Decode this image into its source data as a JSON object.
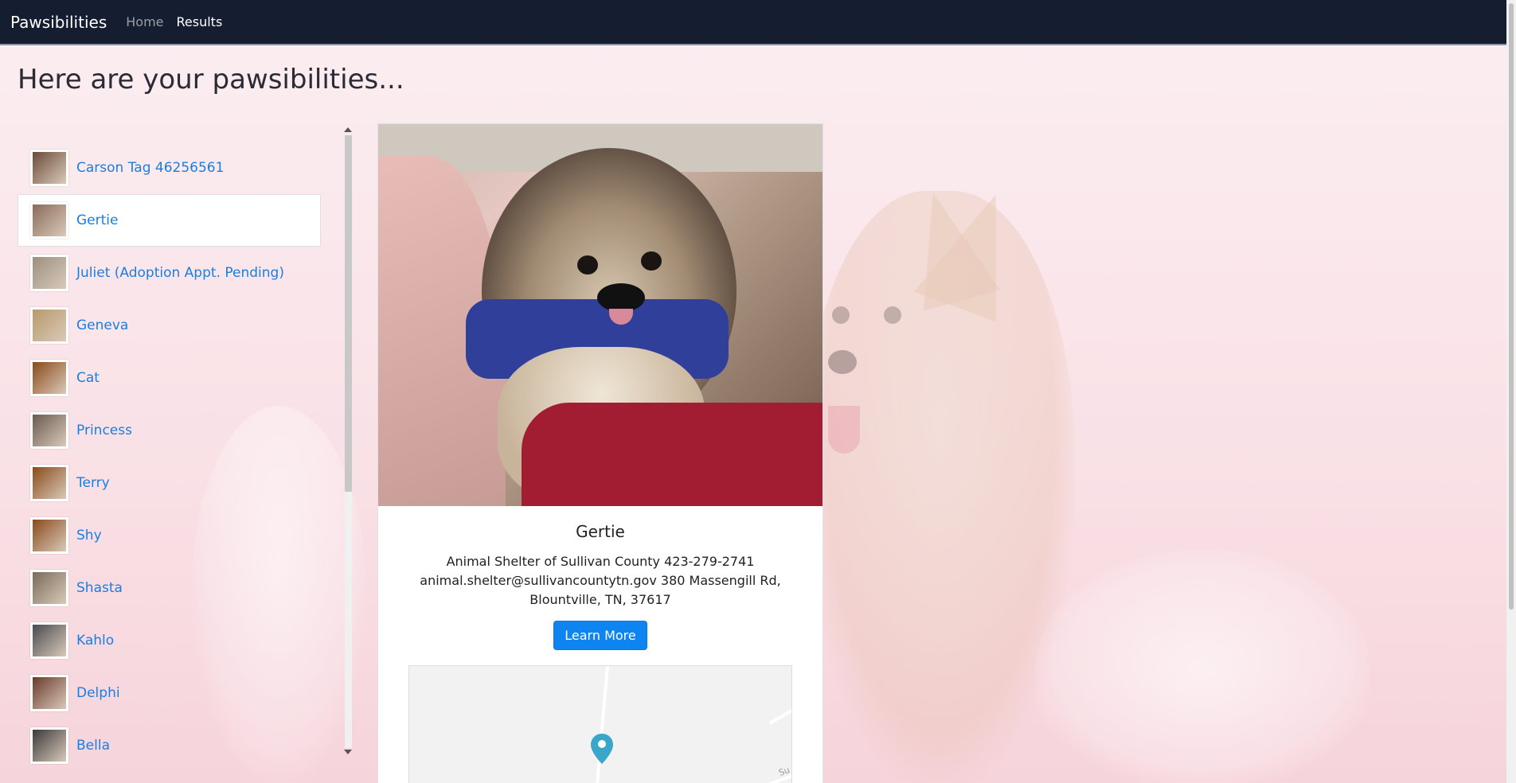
{
  "navbar": {
    "brand": "Pawsibilities",
    "links": [
      {
        "label": "Home",
        "active": false
      },
      {
        "label": "Results",
        "active": true
      }
    ]
  },
  "page": {
    "title": "Here are your pawsibilities..."
  },
  "pets": [
    {
      "name": "Carson Tag 46256561",
      "selected": false,
      "thumb_color": "#6b4a38"
    },
    {
      "name": "Gertie",
      "selected": true,
      "thumb_color": "#8a6a5a"
    },
    {
      "name": "Juliet (Adoption Appt. Pending)",
      "selected": false,
      "thumb_color": "#9b9080"
    },
    {
      "name": "Geneva",
      "selected": false,
      "thumb_color": "#b89a6a"
    },
    {
      "name": "Cat",
      "selected": false,
      "thumb_color": "#8a4a1a"
    },
    {
      "name": "Princess",
      "selected": false,
      "thumb_color": "#6a5a50"
    },
    {
      "name": "Terry",
      "selected": false,
      "thumb_color": "#8a4a1a"
    },
    {
      "name": "Shy",
      "selected": false,
      "thumb_color": "#8a4a1a"
    },
    {
      "name": "Shasta",
      "selected": false,
      "thumb_color": "#7a6a5a"
    },
    {
      "name": "Kahlo",
      "selected": false,
      "thumb_color": "#4a4a50"
    },
    {
      "name": "Delphi",
      "selected": false,
      "thumb_color": "#6a3a2a"
    },
    {
      "name": "Bella",
      "selected": false,
      "thumb_color": "#3a3a3a"
    }
  ],
  "detail": {
    "name": "Gertie",
    "contact": "Animal Shelter of Sullivan County 423-279-2741 animal.shelter@sullivancountytn.gov 380 Massengill Rd, Blountville, TN, 37617",
    "button_label": "Learn More",
    "map_label": "Su",
    "pin_color": "#3aa6c9"
  }
}
